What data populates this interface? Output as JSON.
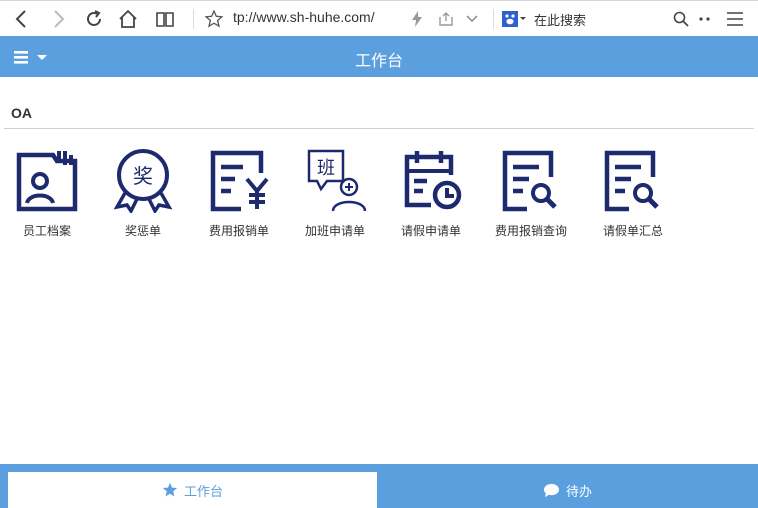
{
  "browser": {
    "url": "tp://www.sh-huhe.com/",
    "search_placeholder": "在此搜索",
    "icons": [
      "back-icon",
      "forward-icon",
      "reload-icon",
      "home-icon",
      "reader-icon",
      "favorite-star-icon",
      "lightning-icon",
      "share-icon",
      "dropdown-icon",
      "baidu-paw-icon",
      "search-icon",
      "more-icon",
      "menu-icon"
    ]
  },
  "header": {
    "title": "工作台",
    "menu_icon": "hamburger-icon"
  },
  "section": {
    "title": "OA"
  },
  "tiles": [
    {
      "label": "员工档案",
      "icon": "employee-file-icon"
    },
    {
      "label": "奖惩单",
      "icon": "award-ribbon-icon"
    },
    {
      "label": "费用报销单",
      "icon": "expense-form-icon"
    },
    {
      "label": "加班申请单",
      "icon": "overtime-user-icon"
    },
    {
      "label": "请假申请单",
      "icon": "calendar-clock-icon"
    },
    {
      "label": "费用报销查询",
      "icon": "document-search-icon"
    },
    {
      "label": "请假单汇总",
      "icon": "document-search-icon"
    }
  ],
  "tabs": [
    {
      "label": "工作台",
      "icon": "star-icon",
      "active": true
    },
    {
      "label": "待办",
      "icon": "chat-bubble-icon",
      "active": false
    }
  ],
  "colors": {
    "primary": "#5b9fdf",
    "icon_navy": "#1e2a6e"
  }
}
